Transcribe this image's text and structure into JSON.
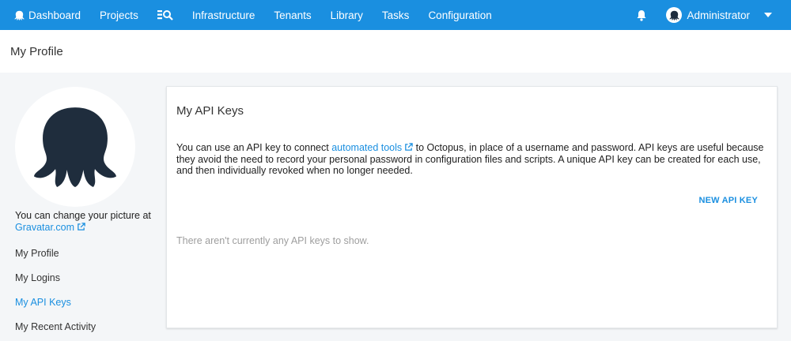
{
  "nav": {
    "dashboard": "Dashboard",
    "projects": "Projects",
    "infrastructure": "Infrastructure",
    "tenants": "Tenants",
    "library": "Library",
    "tasks": "Tasks",
    "configuration": "Configuration",
    "user": "Administrator"
  },
  "icons": {
    "dashboard": "octopus-icon",
    "search": "search-list-icon",
    "bell": "bell-icon",
    "avatar": "user-avatar-icon",
    "caret": "caret-down-icon",
    "external": "external-link-icon"
  },
  "page": {
    "title": "My Profile"
  },
  "sidebar": {
    "picture_text": "You can change your picture at",
    "gravatar_link": "Gravatar.com",
    "items": [
      {
        "label": "My Profile",
        "active": false
      },
      {
        "label": "My Logins",
        "active": false
      },
      {
        "label": "My API Keys",
        "active": true
      },
      {
        "label": "My Recent Activity",
        "active": false
      }
    ]
  },
  "card": {
    "title": "My API Keys",
    "desc_before": "You can use an API key to connect ",
    "desc_link": "automated tools",
    "desc_after": " to Octopus, in place of a username and password. API keys are useful because they avoid the need to record your personal password in configuration files and scripts. A unique API key can be created for each use, and then individually revoked when no longer needed.",
    "new_button": "NEW API KEY",
    "empty_message": "There aren't currently any API keys to show."
  },
  "colors": {
    "primary": "#1a8fe0",
    "octopus": "#1f2d3d",
    "background": "#f4f6f8"
  }
}
